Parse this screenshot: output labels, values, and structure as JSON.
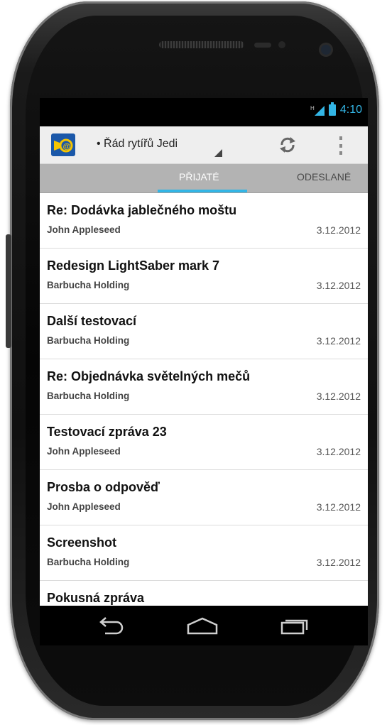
{
  "status_bar": {
    "time": "4:10",
    "network_icon": "signal-h-icon",
    "battery_icon": "battery-icon"
  },
  "action_bar": {
    "app_icon": "mail-horn-icon",
    "account": "• Řád rytířů Jedi",
    "sync_icon": "sync-icon",
    "overflow_icon": "overflow-menu-icon"
  },
  "tabs": [
    {
      "label": "PŘIJATÉ",
      "active": true
    },
    {
      "label": "ODESLANÉ",
      "active": false
    }
  ],
  "messages": [
    {
      "subject": "Re: Dodávka jablečného moštu",
      "sender": "John Appleseed",
      "date": "3.12.2012"
    },
    {
      "subject": "Redesign LightSaber mark 7",
      "sender": "Barbucha Holding",
      "date": "3.12.2012"
    },
    {
      "subject": "Další testovací",
      "sender": "Barbucha Holding",
      "date": "3.12.2012"
    },
    {
      "subject": "Re: Objednávka světelných mečů",
      "sender": "Barbucha Holding",
      "date": "3.12.2012"
    },
    {
      "subject": "Testovací zpráva 23",
      "sender": "John Appleseed",
      "date": "3.12.2012"
    },
    {
      "subject": "Prosba o odpověď",
      "sender": "John Appleseed",
      "date": "3.12.2012"
    },
    {
      "subject": "Screenshot",
      "sender": "Barbucha Holding",
      "date": "3.12.2012"
    },
    {
      "subject": "Pokusná zpráva",
      "sender": "",
      "date": ""
    }
  ],
  "nav_bar": {
    "back_icon": "back-icon",
    "home_icon": "home-icon",
    "recents_icon": "recent-apps-icon"
  },
  "colors": {
    "accent": "#33b5e5",
    "app_icon_bg": "#1b58a9"
  }
}
